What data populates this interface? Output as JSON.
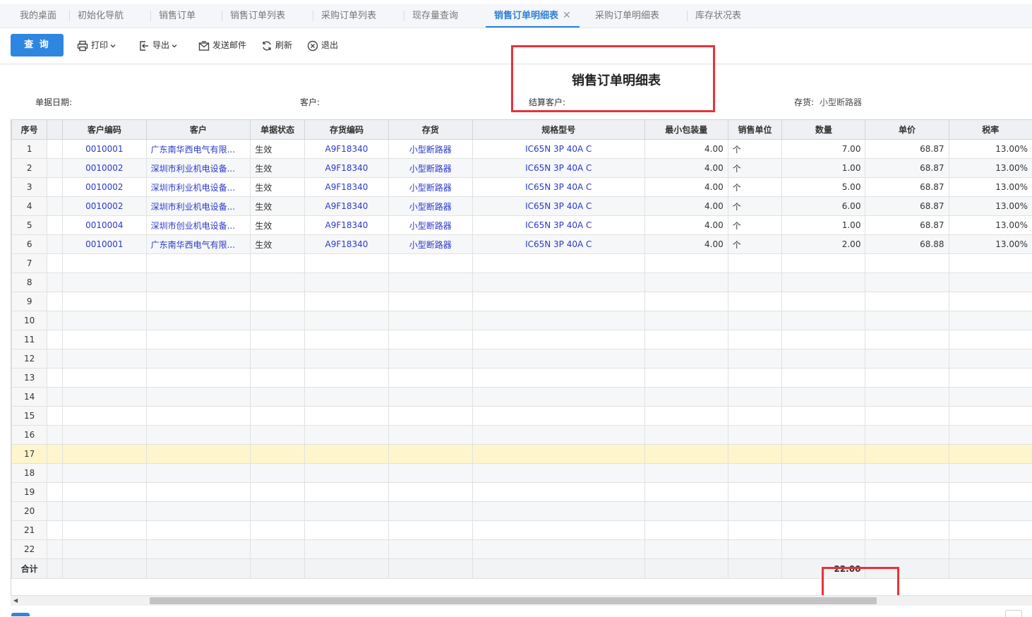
{
  "tabs": [
    {
      "label": "我的桌面"
    },
    {
      "label": "初始化导航"
    },
    {
      "label": "销售订单"
    },
    {
      "label": "销售订单列表"
    },
    {
      "label": "采购订单列表"
    },
    {
      "label": "现存量查询"
    },
    {
      "label": "销售订单明细表",
      "active": true,
      "close": "✕"
    },
    {
      "label": "采购订单明细表"
    },
    {
      "label": "库存状况表"
    }
  ],
  "toolbar": {
    "query": "查 询",
    "print": "打印",
    "export": "导出",
    "email": "发送邮件",
    "refresh": "刷新",
    "exit": "退出"
  },
  "report": {
    "title": "销售订单明细表",
    "criteria": {
      "date_label": "单据日期:",
      "customer_label": "客户:",
      "settle_label": "结算客户:",
      "stock_label": "存货:",
      "stock_value": "小型断路器"
    }
  },
  "columns": [
    "序号",
    "",
    "客户编码",
    "客户",
    "单据状态",
    "存货编码",
    "存货",
    "规格型号",
    "最小包装量",
    "销售单位",
    "数量",
    "单价",
    "税率"
  ],
  "rows": [
    {
      "idx": "1",
      "code": "0010001",
      "customer": "广东南华西电气有限...",
      "status": "生效",
      "stock_code": "A9F18340",
      "stock": "小型断路器",
      "spec": "IC65N 3P 40A C",
      "min_pack": "4.00",
      "unit": "个",
      "qty": "7.00",
      "price": "68.87",
      "tax": "13.00%"
    },
    {
      "idx": "2",
      "code": "0010002",
      "customer": "深圳市利业机电设备...",
      "status": "生效",
      "stock_code": "A9F18340",
      "stock": "小型断路器",
      "spec": "IC65N 3P 40A C",
      "min_pack": "4.00",
      "unit": "个",
      "qty": "1.00",
      "price": "68.87",
      "tax": "13.00%"
    },
    {
      "idx": "3",
      "code": "0010002",
      "customer": "深圳市利业机电设备...",
      "status": "生效",
      "stock_code": "A9F18340",
      "stock": "小型断路器",
      "spec": "IC65N 3P 40A C",
      "min_pack": "4.00",
      "unit": "个",
      "qty": "5.00",
      "price": "68.87",
      "tax": "13.00%"
    },
    {
      "idx": "4",
      "code": "0010002",
      "customer": "深圳市利业机电设备...",
      "status": "生效",
      "stock_code": "A9F18340",
      "stock": "小型断路器",
      "spec": "IC65N 3P 40A C",
      "min_pack": "4.00",
      "unit": "个",
      "qty": "6.00",
      "price": "68.87",
      "tax": "13.00%"
    },
    {
      "idx": "5",
      "code": "0010004",
      "customer": "深圳市创业机电设备...",
      "status": "生效",
      "stock_code": "A9F18340",
      "stock": "小型断路器",
      "spec": "IC65N 3P 40A C",
      "min_pack": "4.00",
      "unit": "个",
      "qty": "1.00",
      "price": "68.87",
      "tax": "13.00%"
    },
    {
      "idx": "6",
      "code": "0010001",
      "customer": "广东南华西电气有限...",
      "status": "生效",
      "stock_code": "A9F18340",
      "stock": "小型断路器",
      "spec": "IC65N 3P 40A C",
      "min_pack": "4.00",
      "unit": "个",
      "qty": "2.00",
      "price": "68.88",
      "tax": "13.00%"
    }
  ],
  "empty_rows": [
    "7",
    "8",
    "9",
    "10",
    "11",
    "12",
    "13",
    "14",
    "15",
    "16",
    "17",
    "18",
    "19",
    "20",
    "21",
    "22"
  ],
  "highlight_row": "17",
  "total": {
    "label": "合计",
    "qty": "22.00"
  }
}
